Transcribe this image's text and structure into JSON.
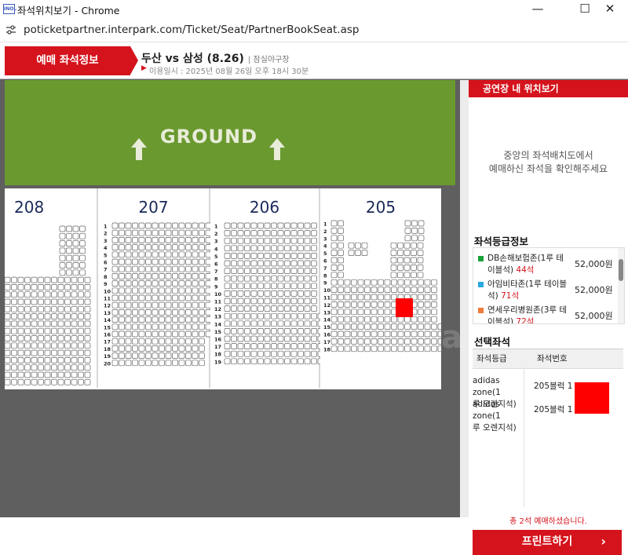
{
  "window": {
    "title": "좌석위치보기 - Chrome",
    "icon_text": "INOL",
    "minimize": "—",
    "maximize": "☐",
    "close": "✕"
  },
  "address": {
    "url": "poticketpartner.interpark.com/Ticket/Seat/PartnerBookSeat.asp"
  },
  "header": {
    "tab_label": "예매 좌석정보",
    "game_title": "두산 vs 삼성 (8.26)",
    "venue": "| 잠실야구장",
    "date_arrow": "▶",
    "date_text": "이용일시 : 2025년 08월 26일 오후 18시 30분"
  },
  "seatmap": {
    "ground_label": "GROUND",
    "stadium_ghost": "a",
    "blocks": [
      {
        "name": "208",
        "rows": []
      },
      {
        "name": "207",
        "rows": [
          "1",
          "2",
          "3",
          "4",
          "5",
          "6",
          "7",
          "8",
          "9",
          "10",
          "11",
          "12",
          "13",
          "14",
          "15",
          "16",
          "17",
          "18",
          "19",
          "20"
        ]
      },
      {
        "name": "206",
        "rows": [
          "1",
          "2",
          "3",
          "4",
          "5",
          "6",
          "7",
          "8",
          "9",
          "10",
          "11",
          "12",
          "13",
          "14",
          "15",
          "16",
          "17",
          "18",
          "19"
        ]
      },
      {
        "name": "205",
        "rows": [
          "1",
          "2",
          "3",
          "4",
          "5",
          "6",
          "7",
          "8",
          "9",
          "10",
          "11",
          "12",
          "13",
          "14",
          "15",
          "16",
          "17",
          "18"
        ]
      }
    ]
  },
  "right_panel": {
    "location_header": "공연장 내 위치보기",
    "location_text_1": "중앙의 좌석배치도에서",
    "location_text_2": "예매하신 좌석을 확인해주세요",
    "grade_title": "좌석등급정보",
    "grades": [
      {
        "name_1": "DB손해보험존(1루 테",
        "name_2": "이블석)",
        "count": "44석",
        "price": "52,000원",
        "color": "#1aa33a"
      },
      {
        "name_1": "아임비타존(1루 테이블",
        "name_2": "석)",
        "count": "71석",
        "price": "52,000원",
        "color": "#2aa8e0"
      },
      {
        "name_1": "연세우리병원존(3루 테",
        "name_2": "이블석)",
        "count": "72석",
        "price": "52,000원",
        "color": "#f07a3a"
      }
    ],
    "selected_title": "선택좌석",
    "col_grade": "좌석등급",
    "col_seat": "좌석번호",
    "selected": [
      {
        "grade_1": "adidas zone(1",
        "grade_2": "루 오렌지석)",
        "seat": "205블럭 1"
      },
      {
        "grade_1": "adidas zone(1",
        "grade_2": "루 오렌지석)",
        "seat": "205블럭 1"
      }
    ],
    "total": "총 2석 예매하셨습니다.",
    "print_label": "프린트하기",
    "print_chevron": "›"
  }
}
